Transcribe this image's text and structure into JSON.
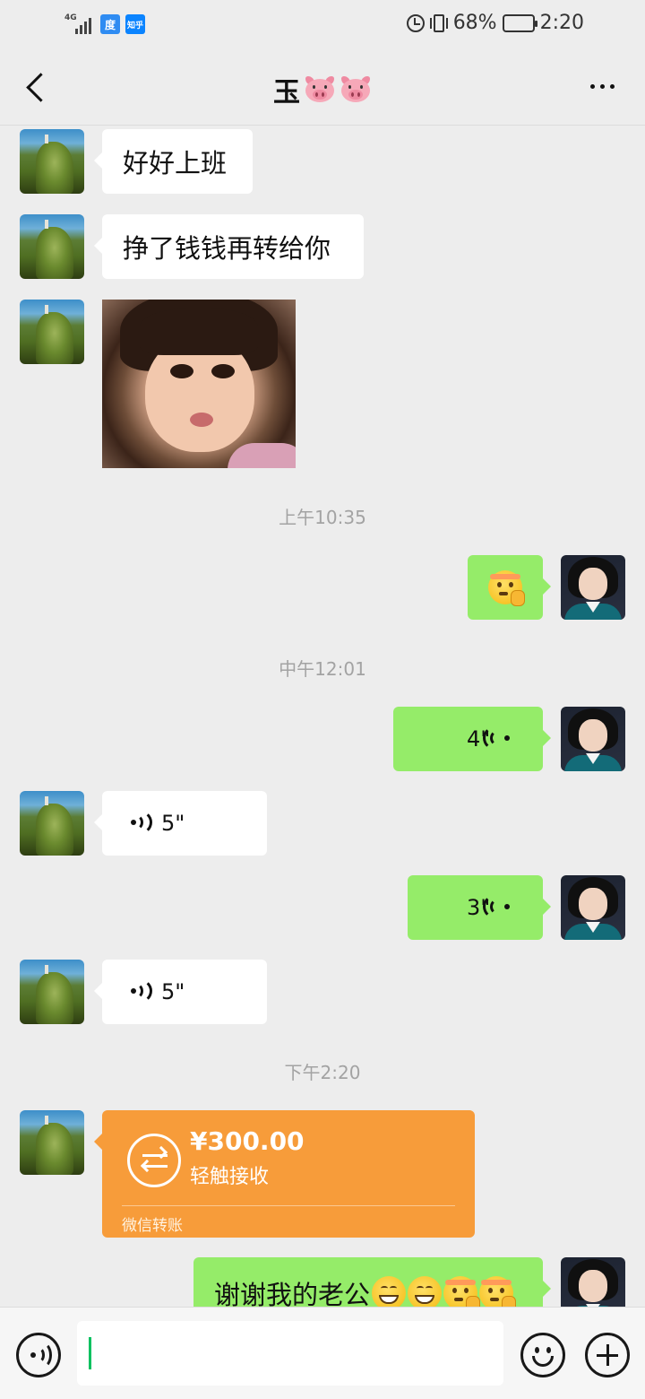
{
  "status_bar": {
    "network": "4G",
    "app_icon_1": "度",
    "app_icon_2": "知乎",
    "battery": "68%",
    "battery_level": 0.68,
    "time": "2:20",
    "icons": [
      "signal-icon",
      "alarm-icon",
      "vibrate-icon",
      "battery-icon"
    ]
  },
  "header": {
    "title": "玉",
    "title_emoji": [
      "pig-face",
      "pig-face"
    ],
    "back_icon": "chevron-left-icon",
    "more_icon": "more-dots-icon"
  },
  "messages": [
    {
      "side": "them",
      "type": "text",
      "text": "好好上班"
    },
    {
      "side": "them",
      "type": "text",
      "text": "挣了钱钱再转给你"
    },
    {
      "side": "them",
      "type": "sticker",
      "description": "girl-pout-sticker"
    },
    {
      "type": "timestamp",
      "text": "上午10:35"
    },
    {
      "side": "me",
      "type": "emoji",
      "emoji": "shushing-face"
    },
    {
      "type": "timestamp",
      "text": "中午12:01"
    },
    {
      "side": "me",
      "type": "voice",
      "duration": "4\""
    },
    {
      "side": "them",
      "type": "voice",
      "duration": "5\""
    },
    {
      "side": "me",
      "type": "voice",
      "duration": "3\""
    },
    {
      "side": "them",
      "type": "voice",
      "duration": "5\""
    },
    {
      "type": "timestamp",
      "text": "下午2:20"
    },
    {
      "side": "them",
      "type": "transfer",
      "amount": "¥300.00",
      "hint": "轻触接收",
      "footer": "微信转账"
    },
    {
      "side": "me",
      "type": "text",
      "text": "谢谢我的老公",
      "emoji": [
        "grinning-face",
        "grinning-face",
        "shushing-face",
        "shushing-face"
      ]
    }
  ],
  "input_bar": {
    "voice_icon": "voice-mode-icon",
    "text_value": "",
    "emoji_icon": "emoji-icon",
    "plus_icon": "plus-icon"
  },
  "colors": {
    "background": "#ededed",
    "my_bubble": "#95ec69",
    "their_bubble": "#ffffff",
    "transfer": "#f79c3a",
    "caret": "#07c160"
  }
}
